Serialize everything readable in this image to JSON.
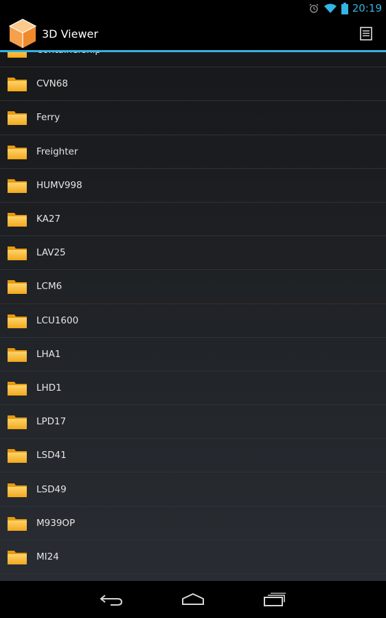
{
  "status_bar": {
    "time": "20:19",
    "icons": [
      "alarm-icon",
      "wifi-icon",
      "battery-icon"
    ]
  },
  "action_bar": {
    "title": "3D Viewer",
    "menu_icon": "document-icon"
  },
  "folders": [
    {
      "label": "Containership"
    },
    {
      "label": "CVN68"
    },
    {
      "label": "Ferry"
    },
    {
      "label": "Freighter"
    },
    {
      "label": "HUMV998"
    },
    {
      "label": "KA27"
    },
    {
      "label": "LAV25"
    },
    {
      "label": "LCM6"
    },
    {
      "label": "LCU1600"
    },
    {
      "label": "LHA1"
    },
    {
      "label": "LHD1"
    },
    {
      "label": "LPD17"
    },
    {
      "label": "LSD41"
    },
    {
      "label": "LSD49"
    },
    {
      "label": "M939OP"
    },
    {
      "label": "MI24"
    }
  ],
  "nav_bar": {
    "buttons": [
      "back-icon",
      "home-icon",
      "recent-apps-icon"
    ]
  },
  "colors": {
    "accent": "#33b5e5",
    "folder": "#f7b733"
  }
}
